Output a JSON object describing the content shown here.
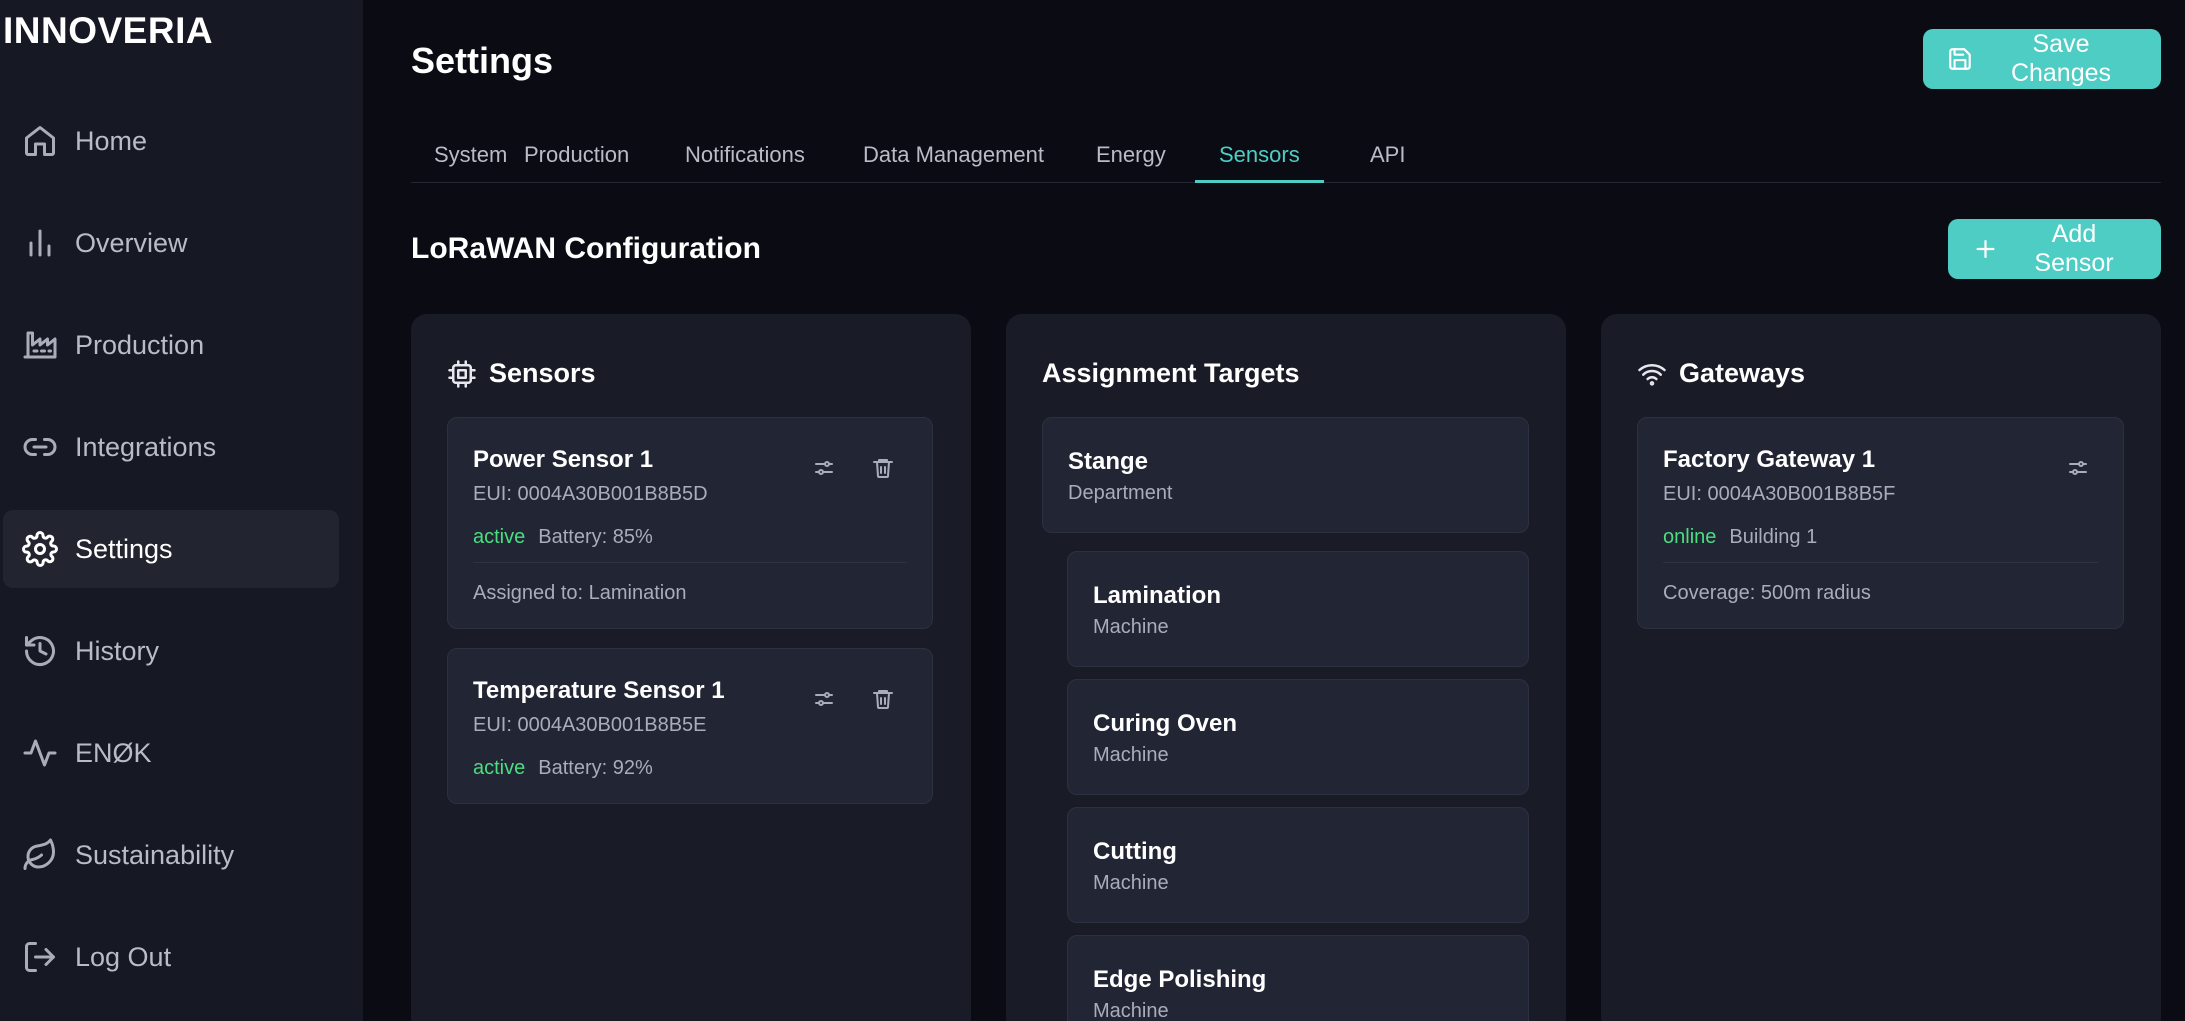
{
  "brand": "INNOVERIA",
  "sidebar": {
    "items": [
      {
        "label": "Home",
        "icon": "home-icon"
      },
      {
        "label": "Overview",
        "icon": "bar-chart-icon"
      },
      {
        "label": "Production",
        "icon": "factory-icon"
      },
      {
        "label": "Integrations",
        "icon": "link-icon"
      },
      {
        "label": "Settings",
        "icon": "gear-icon",
        "active": true
      },
      {
        "label": "History",
        "icon": "history-icon"
      },
      {
        "label": "ENØK",
        "icon": "activity-icon"
      },
      {
        "label": "Sustainability",
        "icon": "leaf-icon"
      },
      {
        "label": "Log Out",
        "icon": "logout-icon"
      }
    ]
  },
  "header": {
    "title": "Settings",
    "save_label": "Save Changes"
  },
  "tabs": [
    {
      "label": "System"
    },
    {
      "label": "Production"
    },
    {
      "label": "Notifications"
    },
    {
      "label": "Data Management"
    },
    {
      "label": "Energy"
    },
    {
      "label": "Sensors",
      "active": true
    },
    {
      "label": "API"
    }
  ],
  "section": {
    "title": "LoRaWAN Configuration",
    "add_label": "Add Sensor"
  },
  "sensors": {
    "title": "Sensors",
    "items": [
      {
        "name": "Power Sensor 1",
        "eui": "EUI: 0004A30B001B8B5D",
        "status": "active",
        "battery": "Battery: 85%",
        "assigned": "Assigned to: Lamination"
      },
      {
        "name": "Temperature Sensor 1",
        "eui": "EUI: 0004A30B001B8B5E",
        "status": "active",
        "battery": "Battery: 92%"
      }
    ]
  },
  "targets": {
    "title": "Assignment Targets",
    "items": [
      {
        "name": "Stange",
        "type": "Department"
      },
      {
        "name": "Lamination",
        "type": "Machine"
      },
      {
        "name": "Curing Oven",
        "type": "Machine"
      },
      {
        "name": "Cutting",
        "type": "Machine"
      },
      {
        "name": "Edge Polishing",
        "type": "Machine"
      }
    ]
  },
  "gateways": {
    "title": "Gateways",
    "items": [
      {
        "name": "Factory Gateway 1",
        "eui": "EUI: 0004A30B001B8B5F",
        "status": "online",
        "location": "Building 1",
        "coverage": "Coverage: 500m radius"
      }
    ]
  },
  "colors": {
    "accent": "#4ecdc4",
    "status_ok": "#4ade80",
    "sidebar_bg": "#161824",
    "panel_bg": "#191b26"
  }
}
